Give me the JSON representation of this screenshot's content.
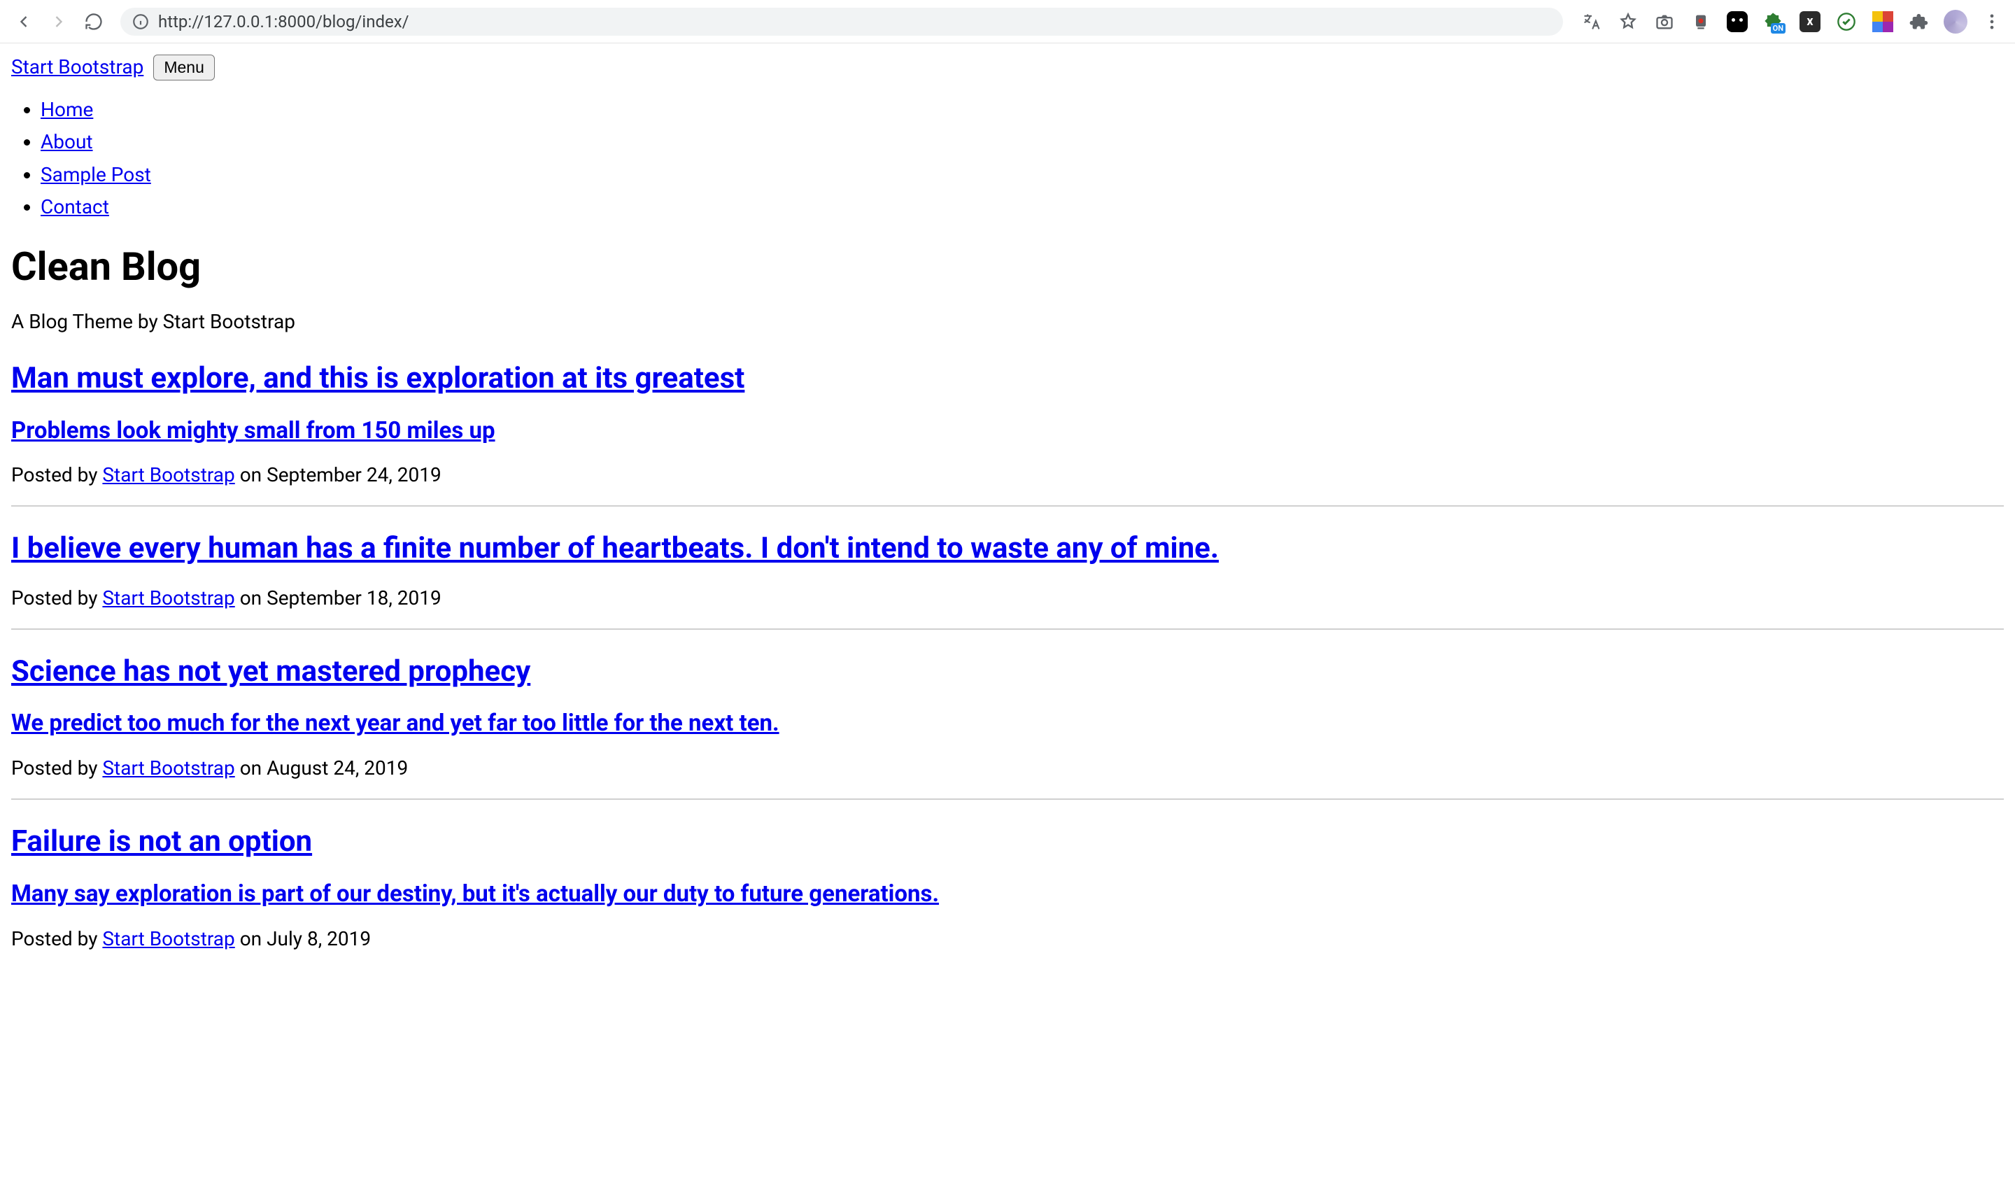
{
  "chrome": {
    "url": "http://127.0.0.1:8000/blog/index/"
  },
  "nav": {
    "brand": "Start Bootstrap",
    "menu_button": "Menu",
    "items": [
      {
        "label": "Home"
      },
      {
        "label": "About"
      },
      {
        "label": "Sample Post"
      },
      {
        "label": "Contact"
      }
    ]
  },
  "header": {
    "title": "Clean Blog",
    "subtitle": "A Blog Theme by Start Bootstrap"
  },
  "posts": [
    {
      "title": "Man must explore, and this is exploration at its greatest",
      "subtitle": "Problems look mighty small from 150 miles up",
      "meta_prefix": "Posted by ",
      "author": "Start Bootstrap",
      "meta_suffix": " on September 24, 2019"
    },
    {
      "title": "I believe every human has a finite number of heartbeats. I don't intend to waste any of mine.",
      "subtitle": "",
      "meta_prefix": "Posted by ",
      "author": "Start Bootstrap",
      "meta_suffix": " on September 18, 2019"
    },
    {
      "title": "Science has not yet mastered prophecy",
      "subtitle": "We predict too much for the next year and yet far too little for the next ten.",
      "meta_prefix": "Posted by ",
      "author": "Start Bootstrap",
      "meta_suffix": " on August 24, 2019"
    },
    {
      "title": "Failure is not an option",
      "subtitle": "Many say exploration is part of our destiny, but it's actually our duty to future generations.",
      "meta_prefix": "Posted by ",
      "author": "Start Bootstrap",
      "meta_suffix": " on July 8, 2019"
    }
  ]
}
